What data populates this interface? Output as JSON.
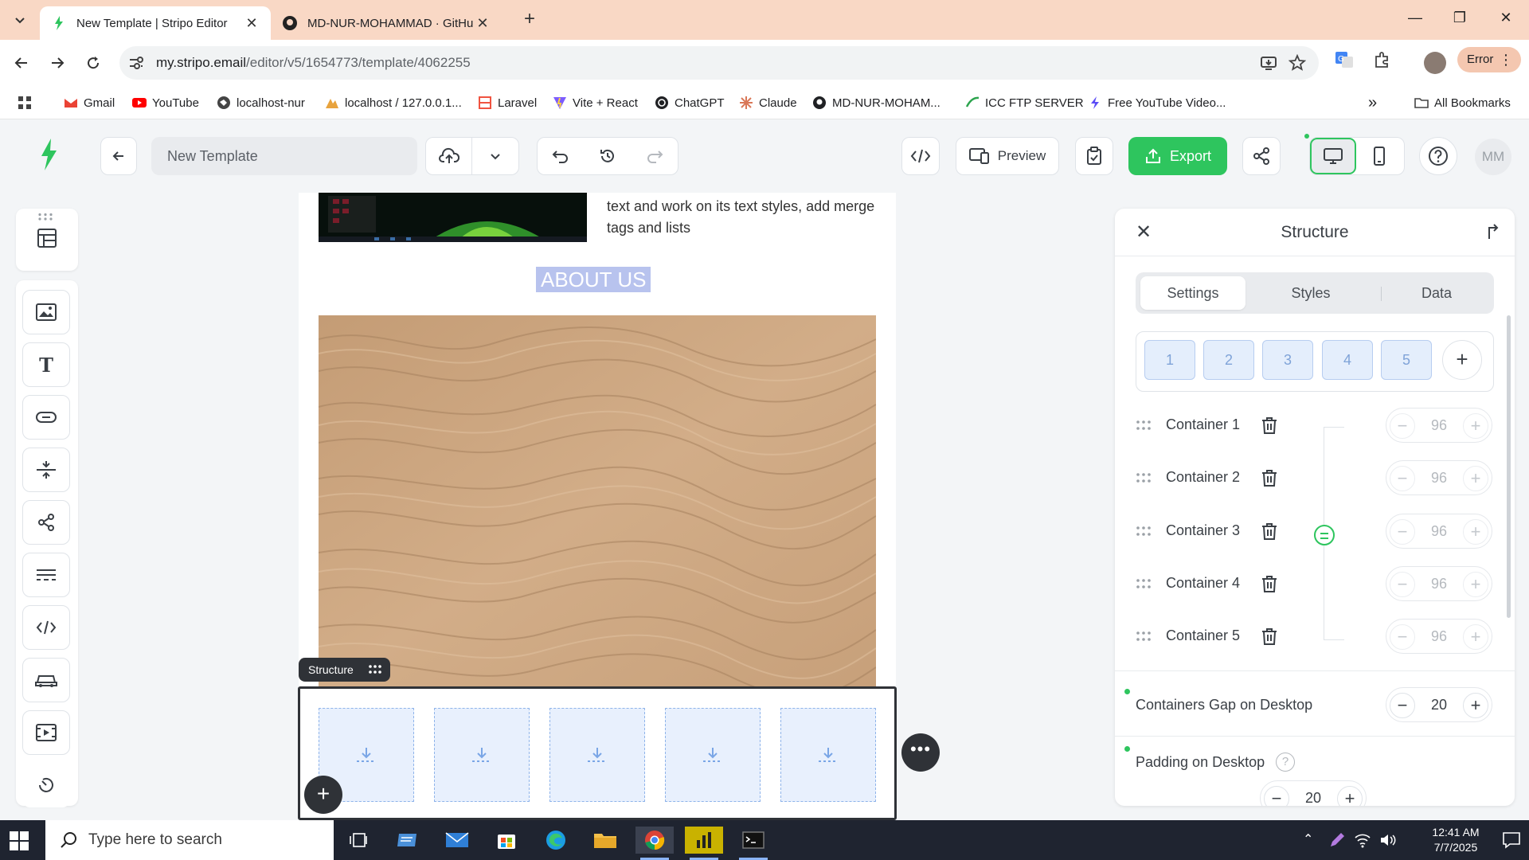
{
  "browser": {
    "tabs": [
      {
        "title": "New Template | Stripo Editor",
        "active": true
      },
      {
        "title": "MD-NUR-MOHAMMAD · GitHu",
        "active": false
      }
    ],
    "url_domain": "my.stripo.email",
    "url_path": "/editor/v5/1654773/template/4062255",
    "profile_status": "Error",
    "bookmarks": [
      "Gmail",
      "YouTube",
      "localhost-nur",
      "localhost / 127.0.0.1...",
      "Laravel",
      "Vite + React",
      "ChatGPT",
      "Claude",
      "MD-NUR-MOHAM...",
      "ICC FTP SERVER",
      "Free YouTube Video..."
    ],
    "all_bookmarks": "All Bookmarks"
  },
  "editor": {
    "template_name": "New Template",
    "preview_label": "Preview",
    "export_label": "Export",
    "avatar_initials": "MM",
    "accent_color": "#2ec55e"
  },
  "canvas": {
    "body_text": "text and work on its text styles, add merge tags and lists",
    "heading": "ABOUT US",
    "structure_tag": "Structure"
  },
  "panel": {
    "title": "Structure",
    "tabs": [
      "Settings",
      "Styles",
      "Data"
    ],
    "column_options": [
      "1",
      "2",
      "3",
      "4",
      "5"
    ],
    "containers": [
      {
        "label": "Container 1",
        "width": "96"
      },
      {
        "label": "Container 2",
        "width": "96"
      },
      {
        "label": "Container 3",
        "width": "96"
      },
      {
        "label": "Container 4",
        "width": "96"
      },
      {
        "label": "Container 5",
        "width": "96"
      }
    ],
    "gap_label": "Containers Gap on Desktop",
    "gap_value": "20",
    "padding_label": "Padding on Desktop",
    "padding_value": "20",
    "help_glyph": "?"
  },
  "taskbar": {
    "search_placeholder": "Type here to search",
    "time": "12:41 AM",
    "date": "7/7/2025"
  }
}
